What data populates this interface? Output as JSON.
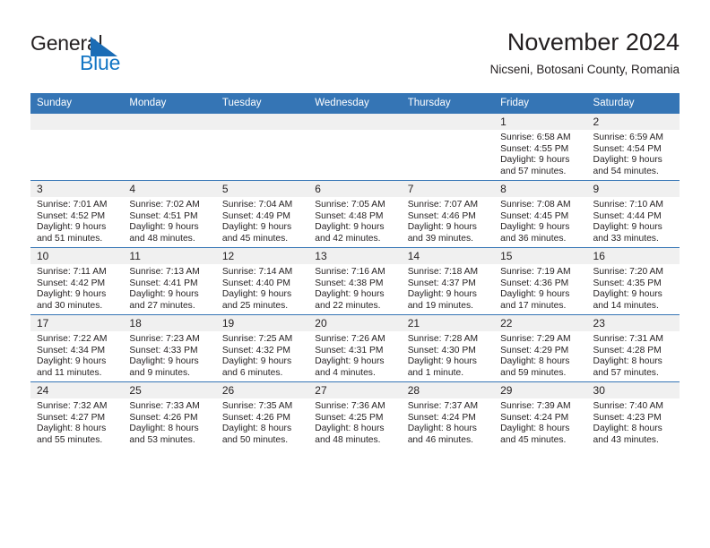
{
  "brand": {
    "name_part1": "General",
    "name_part2": "Blue",
    "triangle_color": "#1b6cb5",
    "blue_text_color": "#1275c4"
  },
  "header": {
    "title": "November 2024",
    "subtitle": "Nicseni, Botosani County, Romania",
    "accent_color": "#3575b5",
    "daynum_band_color": "#f0f0f0"
  },
  "weekdays": [
    "Sunday",
    "Monday",
    "Tuesday",
    "Wednesday",
    "Thursday",
    "Friday",
    "Saturday"
  ],
  "labels": {
    "sunrise_prefix": "Sunrise:",
    "sunset_prefix": "Sunset:",
    "daylight_prefix": "Daylight:"
  },
  "weeks": [
    [
      {
        "empty": true
      },
      {
        "empty": true
      },
      {
        "empty": true
      },
      {
        "empty": true
      },
      {
        "empty": true
      },
      {
        "day": "1",
        "sunrise": "Sunrise: 6:58 AM",
        "sunset": "Sunset: 4:55 PM",
        "daylight1": "Daylight: 9 hours",
        "daylight2": "and 57 minutes."
      },
      {
        "day": "2",
        "sunrise": "Sunrise: 6:59 AM",
        "sunset": "Sunset: 4:54 PM",
        "daylight1": "Daylight: 9 hours",
        "daylight2": "and 54 minutes."
      }
    ],
    [
      {
        "day": "3",
        "sunrise": "Sunrise: 7:01 AM",
        "sunset": "Sunset: 4:52 PM",
        "daylight1": "Daylight: 9 hours",
        "daylight2": "and 51 minutes."
      },
      {
        "day": "4",
        "sunrise": "Sunrise: 7:02 AM",
        "sunset": "Sunset: 4:51 PM",
        "daylight1": "Daylight: 9 hours",
        "daylight2": "and 48 minutes."
      },
      {
        "day": "5",
        "sunrise": "Sunrise: 7:04 AM",
        "sunset": "Sunset: 4:49 PM",
        "daylight1": "Daylight: 9 hours",
        "daylight2": "and 45 minutes."
      },
      {
        "day": "6",
        "sunrise": "Sunrise: 7:05 AM",
        "sunset": "Sunset: 4:48 PM",
        "daylight1": "Daylight: 9 hours",
        "daylight2": "and 42 minutes."
      },
      {
        "day": "7",
        "sunrise": "Sunrise: 7:07 AM",
        "sunset": "Sunset: 4:46 PM",
        "daylight1": "Daylight: 9 hours",
        "daylight2": "and 39 minutes."
      },
      {
        "day": "8",
        "sunrise": "Sunrise: 7:08 AM",
        "sunset": "Sunset: 4:45 PM",
        "daylight1": "Daylight: 9 hours",
        "daylight2": "and 36 minutes."
      },
      {
        "day": "9",
        "sunrise": "Sunrise: 7:10 AM",
        "sunset": "Sunset: 4:44 PM",
        "daylight1": "Daylight: 9 hours",
        "daylight2": "and 33 minutes."
      }
    ],
    [
      {
        "day": "10",
        "sunrise": "Sunrise: 7:11 AM",
        "sunset": "Sunset: 4:42 PM",
        "daylight1": "Daylight: 9 hours",
        "daylight2": "and 30 minutes."
      },
      {
        "day": "11",
        "sunrise": "Sunrise: 7:13 AM",
        "sunset": "Sunset: 4:41 PM",
        "daylight1": "Daylight: 9 hours",
        "daylight2": "and 27 minutes."
      },
      {
        "day": "12",
        "sunrise": "Sunrise: 7:14 AM",
        "sunset": "Sunset: 4:40 PM",
        "daylight1": "Daylight: 9 hours",
        "daylight2": "and 25 minutes."
      },
      {
        "day": "13",
        "sunrise": "Sunrise: 7:16 AM",
        "sunset": "Sunset: 4:38 PM",
        "daylight1": "Daylight: 9 hours",
        "daylight2": "and 22 minutes."
      },
      {
        "day": "14",
        "sunrise": "Sunrise: 7:18 AM",
        "sunset": "Sunset: 4:37 PM",
        "daylight1": "Daylight: 9 hours",
        "daylight2": "and 19 minutes."
      },
      {
        "day": "15",
        "sunrise": "Sunrise: 7:19 AM",
        "sunset": "Sunset: 4:36 PM",
        "daylight1": "Daylight: 9 hours",
        "daylight2": "and 17 minutes."
      },
      {
        "day": "16",
        "sunrise": "Sunrise: 7:20 AM",
        "sunset": "Sunset: 4:35 PM",
        "daylight1": "Daylight: 9 hours",
        "daylight2": "and 14 minutes."
      }
    ],
    [
      {
        "day": "17",
        "sunrise": "Sunrise: 7:22 AM",
        "sunset": "Sunset: 4:34 PM",
        "daylight1": "Daylight: 9 hours",
        "daylight2": "and 11 minutes."
      },
      {
        "day": "18",
        "sunrise": "Sunrise: 7:23 AM",
        "sunset": "Sunset: 4:33 PM",
        "daylight1": "Daylight: 9 hours",
        "daylight2": "and 9 minutes."
      },
      {
        "day": "19",
        "sunrise": "Sunrise: 7:25 AM",
        "sunset": "Sunset: 4:32 PM",
        "daylight1": "Daylight: 9 hours",
        "daylight2": "and 6 minutes."
      },
      {
        "day": "20",
        "sunrise": "Sunrise: 7:26 AM",
        "sunset": "Sunset: 4:31 PM",
        "daylight1": "Daylight: 9 hours",
        "daylight2": "and 4 minutes."
      },
      {
        "day": "21",
        "sunrise": "Sunrise: 7:28 AM",
        "sunset": "Sunset: 4:30 PM",
        "daylight1": "Daylight: 9 hours",
        "daylight2": "and 1 minute."
      },
      {
        "day": "22",
        "sunrise": "Sunrise: 7:29 AM",
        "sunset": "Sunset: 4:29 PM",
        "daylight1": "Daylight: 8 hours",
        "daylight2": "and 59 minutes."
      },
      {
        "day": "23",
        "sunrise": "Sunrise: 7:31 AM",
        "sunset": "Sunset: 4:28 PM",
        "daylight1": "Daylight: 8 hours",
        "daylight2": "and 57 minutes."
      }
    ],
    [
      {
        "day": "24",
        "sunrise": "Sunrise: 7:32 AM",
        "sunset": "Sunset: 4:27 PM",
        "daylight1": "Daylight: 8 hours",
        "daylight2": "and 55 minutes."
      },
      {
        "day": "25",
        "sunrise": "Sunrise: 7:33 AM",
        "sunset": "Sunset: 4:26 PM",
        "daylight1": "Daylight: 8 hours",
        "daylight2": "and 53 minutes."
      },
      {
        "day": "26",
        "sunrise": "Sunrise: 7:35 AM",
        "sunset": "Sunset: 4:26 PM",
        "daylight1": "Daylight: 8 hours",
        "daylight2": "and 50 minutes."
      },
      {
        "day": "27",
        "sunrise": "Sunrise: 7:36 AM",
        "sunset": "Sunset: 4:25 PM",
        "daylight1": "Daylight: 8 hours",
        "daylight2": "and 48 minutes."
      },
      {
        "day": "28",
        "sunrise": "Sunrise: 7:37 AM",
        "sunset": "Sunset: 4:24 PM",
        "daylight1": "Daylight: 8 hours",
        "daylight2": "and 46 minutes."
      },
      {
        "day": "29",
        "sunrise": "Sunrise: 7:39 AM",
        "sunset": "Sunset: 4:24 PM",
        "daylight1": "Daylight: 8 hours",
        "daylight2": "and 45 minutes."
      },
      {
        "day": "30",
        "sunrise": "Sunrise: 7:40 AM",
        "sunset": "Sunset: 4:23 PM",
        "daylight1": "Daylight: 8 hours",
        "daylight2": "and 43 minutes."
      }
    ]
  ]
}
